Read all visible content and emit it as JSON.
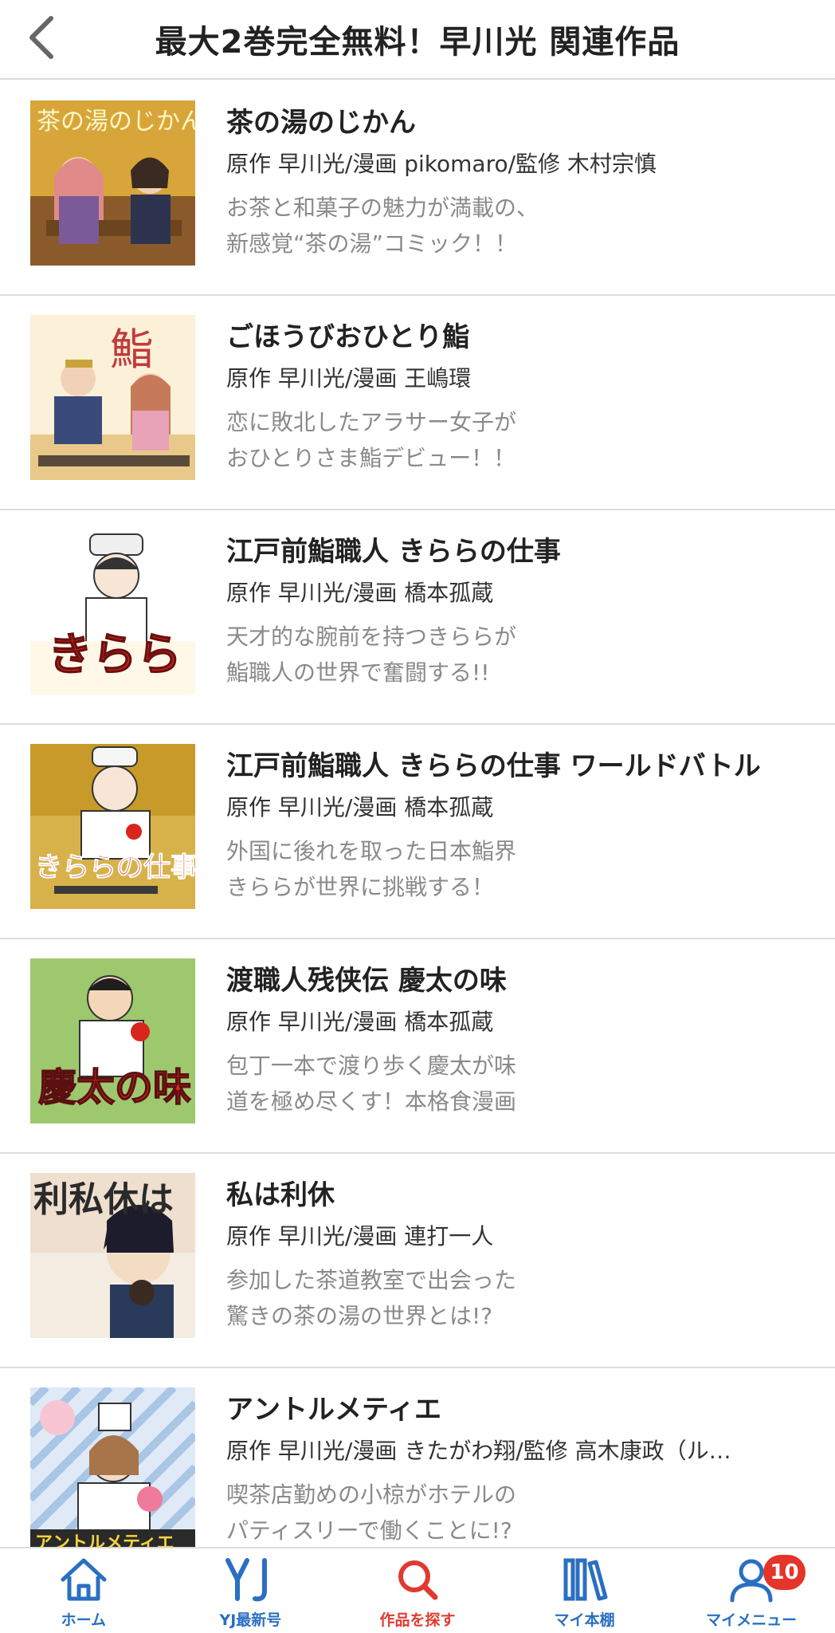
{
  "header": {
    "title": "最大2巻完全無料！早川光 関連作品"
  },
  "items": [
    {
      "title": "茶の湯のじかん",
      "credit": "原作 早川光/漫画 pikomaro/監修 木村宗慎",
      "desc1": "お茶と和菓子の魅力が満載の、",
      "desc2": "新感覚“茶の湯”コミック！！",
      "cover_text": "茶の湯のじかん"
    },
    {
      "title": "ごほうびおひとり鮨",
      "credit": "原作 早川光/漫画 王嶋環",
      "desc1": "恋に敗北したアラサー女子が",
      "desc2": "おひとりさま鮨デビュー！！",
      "cover_text": "鮨"
    },
    {
      "title": "江戸前鮨職人 きららの仕事",
      "credit": "原作 早川光/漫画 橋本孤蔵",
      "desc1": "天才的な腕前を持つきららが",
      "desc2": "鮨職人の世界で奮闘する!!",
      "cover_text": "きらら"
    },
    {
      "title": "江戸前鮨職人 きららの仕事 ワールドバトル",
      "credit": "原作 早川光/漫画 橋本孤蔵",
      "desc1": "外国に後れを取った日本鮨界",
      "desc2": "きららが世界に挑戦する！",
      "cover_text": "きららの仕事"
    },
    {
      "title": "渡職人残侠伝 慶太の味",
      "credit": "原作 早川光/漫画 橋本孤蔵",
      "desc1": "包丁一本で渡り歩く慶太が味",
      "desc2": "道を極め尽くす！本格食漫画",
      "cover_text": "慶太の味"
    },
    {
      "title": "私は利休",
      "credit": "原作 早川光/漫画 連打一人",
      "desc1": "参加した茶道教室で出会った",
      "desc2": "驚きの茶の湯の世界とは!?",
      "cover_text": "利私休は"
    },
    {
      "title": "アントルメティエ",
      "credit": "原作 早川光/漫画 きたがわ翔/監修 高木康政（ル…",
      "desc1": "喫茶店勤めの小椋がホテルの",
      "desc2": "パティスリーで働くことに!?",
      "cover_text": "アントルメティエ"
    }
  ],
  "tabbar": {
    "tabs": [
      {
        "label": "ホーム",
        "icon": "home-icon"
      },
      {
        "label": "YJ最新号",
        "icon": "yj-icon"
      },
      {
        "label": "作品を探す",
        "icon": "search-icon"
      },
      {
        "label": "マイ本棚",
        "icon": "bookshelf-icon"
      },
      {
        "label": "マイメニュー",
        "icon": "user-icon"
      }
    ],
    "badge": "10",
    "active_color": "#e03a30",
    "color": "#2a6fc1"
  }
}
